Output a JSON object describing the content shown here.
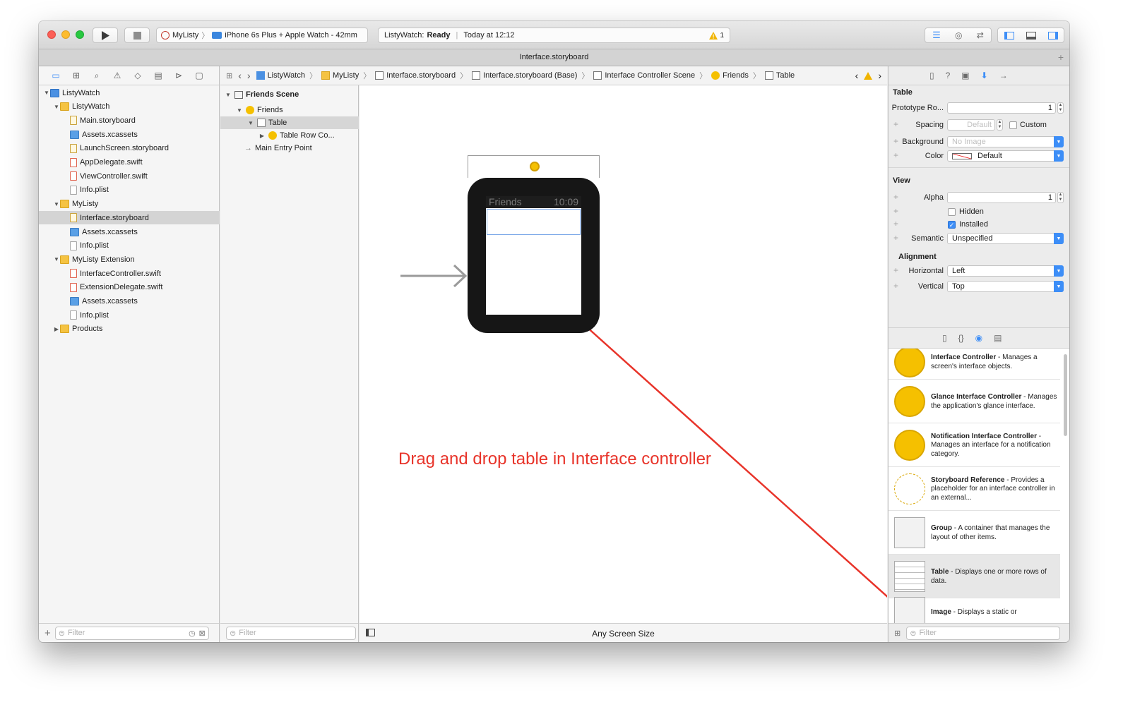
{
  "toolbar": {
    "scheme_app": "MyListy",
    "scheme_device": "iPhone 6s Plus + Apple Watch - 42mm",
    "status_target": "ListyWatch:",
    "status_state": "Ready",
    "status_time": "Today at 12:12",
    "warning_count": "1"
  },
  "tab_title": "Interface.storyboard",
  "navigator": {
    "items": [
      {
        "label": "ListyWatch",
        "kind": "project",
        "indent": 0,
        "open": true
      },
      {
        "label": "ListyWatch",
        "kind": "folder",
        "indent": 1,
        "open": true
      },
      {
        "label": "Main.storyboard",
        "kind": "story",
        "indent": 2
      },
      {
        "label": "Assets.xcassets",
        "kind": "asset",
        "indent": 2
      },
      {
        "label": "LaunchScreen.storyboard",
        "kind": "story",
        "indent": 2
      },
      {
        "label": "AppDelegate.swift",
        "kind": "swift",
        "indent": 2
      },
      {
        "label": "ViewController.swift",
        "kind": "swift",
        "indent": 2
      },
      {
        "label": "Info.plist",
        "kind": "file",
        "indent": 2
      },
      {
        "label": "MyListy",
        "kind": "folder",
        "indent": 1,
        "open": true
      },
      {
        "label": "Interface.storyboard",
        "kind": "story",
        "indent": 2,
        "selected": true
      },
      {
        "label": "Assets.xcassets",
        "kind": "asset",
        "indent": 2
      },
      {
        "label": "Info.plist",
        "kind": "file",
        "indent": 2
      },
      {
        "label": "MyListy Extension",
        "kind": "folder",
        "indent": 1,
        "open": true
      },
      {
        "label": "InterfaceController.swift",
        "kind": "swift",
        "indent": 2
      },
      {
        "label": "ExtensionDelegate.swift",
        "kind": "swift",
        "indent": 2
      },
      {
        "label": "Assets.xcassets",
        "kind": "asset",
        "indent": 2
      },
      {
        "label": "Info.plist",
        "kind": "file",
        "indent": 2
      },
      {
        "label": "Products",
        "kind": "folder",
        "indent": 1,
        "open": false
      }
    ],
    "filter_placeholder": "Filter"
  },
  "outline": {
    "scene": "Friends Scene",
    "friends": "Friends",
    "table": "Table",
    "table_row": "Table Row Co...",
    "entry": "Main Entry Point",
    "filter_placeholder": "Filter"
  },
  "jumpbar": {
    "crumbs": [
      "ListyWatch",
      "MyListy",
      "Interface.storyboard",
      "Interface.storyboard (Base)",
      "Interface Controller Scene",
      "Friends",
      "Table"
    ]
  },
  "canvas": {
    "watch_title": "Friends",
    "watch_time": "10:09",
    "annotation": "Drag and drop table in Interface controller",
    "footer": "Any Screen Size"
  },
  "inspector": {
    "table_section": "Table",
    "prototype_label": "Prototype Ro...",
    "prototype_value": "1",
    "spacing_label": "Spacing",
    "spacing_placeholder": "Default",
    "custom_label": "Custom",
    "background_label": "Background",
    "background_placeholder": "No Image",
    "color_label": "Color",
    "color_value": "Default",
    "view_section": "View",
    "alpha_label": "Alpha",
    "alpha_value": "1",
    "hidden_label": "Hidden",
    "installed_label": "Installed",
    "semantic_label": "Semantic",
    "semantic_value": "Unspecified",
    "alignment_section": "Alignment",
    "horizontal_label": "Horizontal",
    "horizontal_value": "Left",
    "vertical_label": "Vertical",
    "vertical_value": "Top"
  },
  "library": {
    "items": [
      {
        "title": "Interface Controller",
        "desc": " - Manages a screen's interface objects."
      },
      {
        "title": "Glance Interface Controller",
        "desc": " - Manages the application's glance interface."
      },
      {
        "title": "Notification Interface Controller",
        "desc": " - Manages an interface for a notification category."
      },
      {
        "title": "Storyboard Reference",
        "desc": " - Provides a placeholder for an interface controller in an external..."
      },
      {
        "title": "Group",
        "desc": " - A container that manages the layout of other items."
      },
      {
        "title": "Table",
        "desc": " - Displays one or more rows of data."
      },
      {
        "title": "Image",
        "desc": " - Displays a static or"
      }
    ],
    "filter_placeholder": "Filter"
  },
  "colors": {
    "accent": "#3d8ef7",
    "annotation": "#e8342a",
    "watch_body": "#161616",
    "controller_yellow": "#f5c000"
  }
}
